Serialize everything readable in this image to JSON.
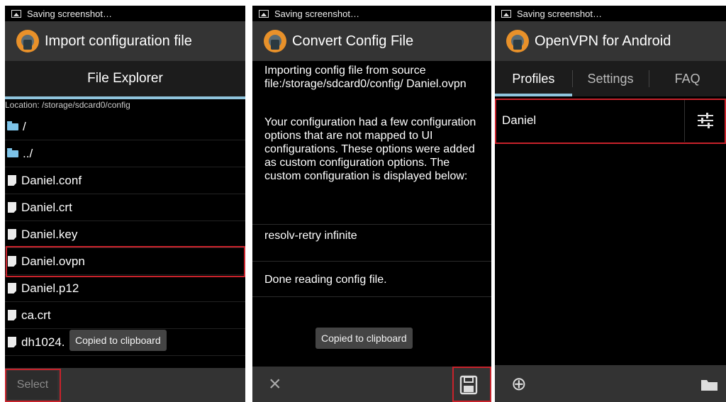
{
  "status": {
    "text": "Saving screenshot…"
  },
  "panel1": {
    "title": "Import configuration file",
    "subtitle": "File Explorer",
    "location": "Location: /storage/sdcard0/config",
    "files": [
      {
        "name": "/",
        "type": "folder"
      },
      {
        "name": "../",
        "type": "folder"
      },
      {
        "name": "Daniel.conf",
        "type": "file"
      },
      {
        "name": "Daniel.crt",
        "type": "file"
      },
      {
        "name": "Daniel.key",
        "type": "file"
      },
      {
        "name": "Daniel.ovpn",
        "type": "file",
        "selected": true
      },
      {
        "name": "Daniel.p12",
        "type": "file"
      },
      {
        "name": "ca.crt",
        "type": "file"
      },
      {
        "name": "dh1024.",
        "type": "file"
      }
    ],
    "toast": "Copied to clipboard",
    "select_label": "Select"
  },
  "panel2": {
    "title": "Convert Config File",
    "import_text": "Importing config file from source file:/storage/sdcard0/config/ Daniel.ovpn",
    "notice_text": "Your configuration had a few configuration options that are not mapped to UI configurations. These options were added as custom configuration options. The custom configuration is displayed below:",
    "custom_option": "resolv-retry infinite",
    "done_text": "Done reading config file.",
    "toast": "Copied to clipboard",
    "cancel_glyph": "×",
    "save_glyph": "save-icon"
  },
  "panel3": {
    "title": "OpenVPN for Android",
    "tabs": [
      "Profiles",
      "Settings",
      "FAQ"
    ],
    "active_tab": "Profiles",
    "profile_name": "Daniel",
    "add_glyph": "⊕",
    "folder_glyph": "folder-icon"
  },
  "colors": {
    "accent": "#8fc4dd",
    "highlight": "#c8222b",
    "logo": "#e8912a"
  }
}
